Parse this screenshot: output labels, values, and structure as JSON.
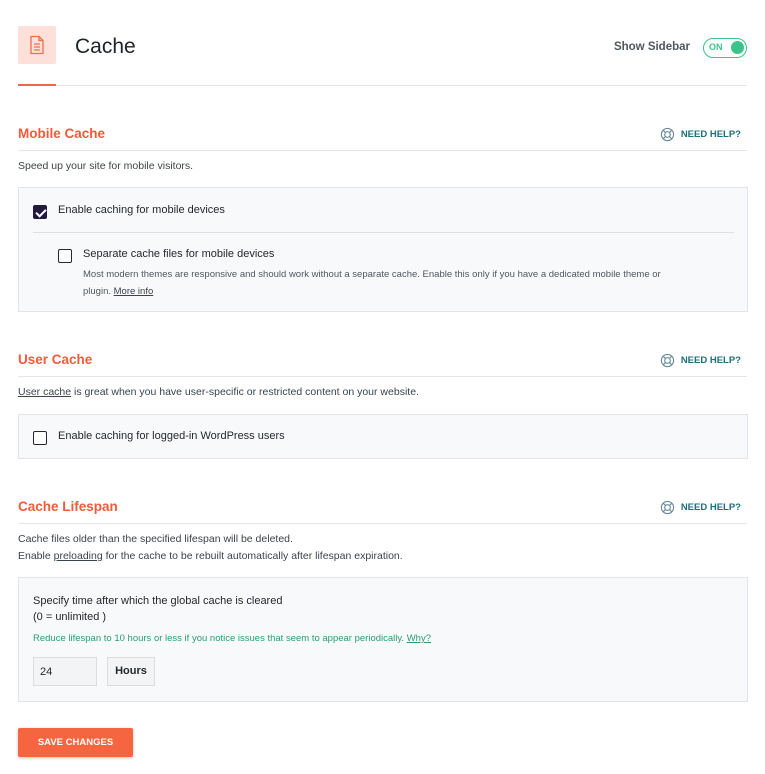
{
  "header": {
    "title": "Cache",
    "show_sidebar_label": "Show Sidebar",
    "toggle_state": "ON"
  },
  "help_label": "NEED HELP?",
  "mobile_cache": {
    "title": "Mobile Cache",
    "description": "Speed up your site for mobile visitors.",
    "enable_label": "Enable caching for mobile devices",
    "enable_checked": true,
    "separate_label": "Separate cache files for mobile devices",
    "separate_checked": false,
    "separate_desc_line1": "Most modern themes are responsive and should work without a separate cache. Enable this only if you have a dedicated mobile theme or",
    "separate_desc_line2_prefix": "plugin.",
    "more_info_link": "More info"
  },
  "user_cache": {
    "title": "User Cache",
    "description_link": "User cache",
    "description_rest": "is great when you have user-specific or restricted content on your website.",
    "enable_label": "Enable caching for logged-in WordPress users",
    "enable_checked": false
  },
  "cache_lifespan": {
    "title": "Cache Lifespan",
    "description_line1": "Cache files older than the specified lifespan will be deleted.",
    "description_line2_prefix": "Enable",
    "preloading_link": "preloading",
    "description_line2_suffix": "for the cache to be rebuilt automatically after lifespan expiration.",
    "field_label_line1": "Specify time after which the global cache is cleared",
    "field_label_line2": "(0 = unlimited )",
    "note_text": "Reduce lifespan to 10 hours or less if you notice issues that seem to appear periodically.",
    "note_link": "Why?",
    "value": "24",
    "unit": "Hours"
  },
  "save_button": "SAVE CHANGES",
  "colors": {
    "accent": "#f56640",
    "section_title": "#f05b3b",
    "toggle_on": "#3ac48c",
    "help_link": "#1d6f7a",
    "note_green": "#2a9d6f",
    "checkbox_checked": "#231a3f"
  }
}
